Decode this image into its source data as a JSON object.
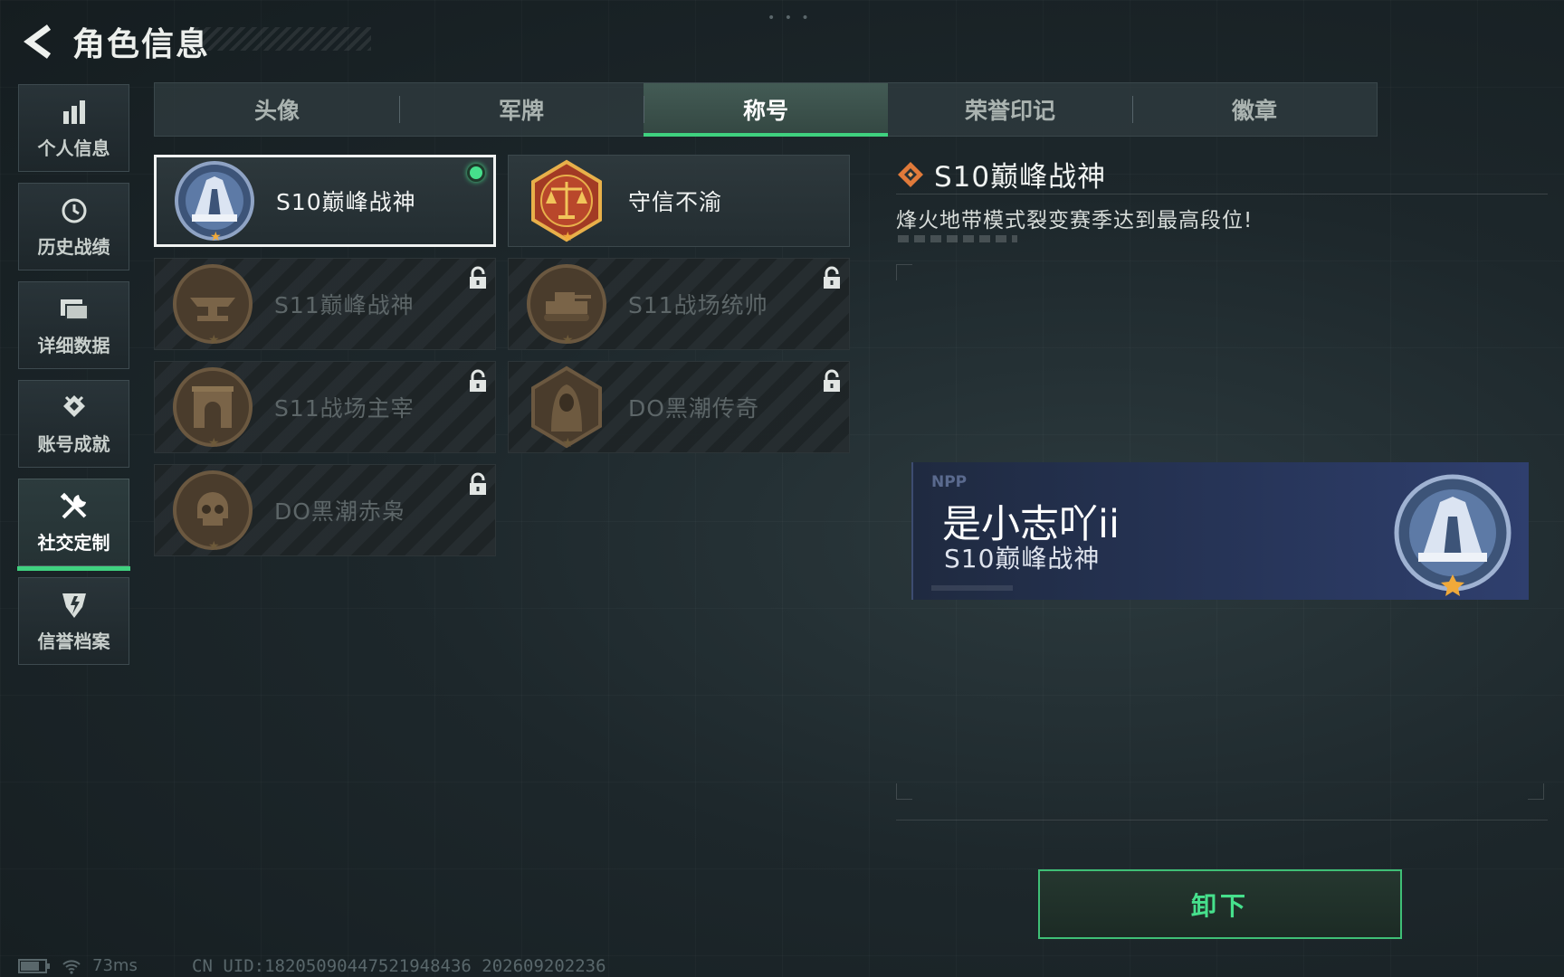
{
  "header": {
    "title": "角色信息"
  },
  "sidebar": {
    "items": [
      {
        "label": "个人信息",
        "icon": "bar-chart-icon"
      },
      {
        "label": "历史战绩",
        "icon": "clock-icon"
      },
      {
        "label": "详细数据",
        "icon": "folder-icon"
      },
      {
        "label": "账号成就",
        "icon": "achievement-icon"
      },
      {
        "label": "社交定制",
        "icon": "tools-icon",
        "active": true
      },
      {
        "label": "信誉档案",
        "icon": "shield-icon"
      }
    ]
  },
  "tabs": [
    {
      "label": "头像"
    },
    {
      "label": "军牌"
    },
    {
      "label": "称号",
      "active": true
    },
    {
      "label": "荣誉印记"
    },
    {
      "label": "徽章"
    }
  ],
  "titles": [
    {
      "name": "S10巅峰战神",
      "locked": false,
      "selected": true,
      "equipped": true,
      "icon": "peak-warrior-emblem-icon"
    },
    {
      "name": "守信不渝",
      "locked": false,
      "selected": false,
      "equipped": false,
      "icon": "scales-emblem-icon"
    },
    {
      "name": "S11巅峰战神",
      "locked": true,
      "icon": "anvil-emblem-icon"
    },
    {
      "name": "S11战场统帅",
      "locked": true,
      "icon": "tank-emblem-icon"
    },
    {
      "name": "S11战场主宰",
      "locked": true,
      "icon": "arch-emblem-icon"
    },
    {
      "name": "DO黑潮传奇",
      "locked": true,
      "icon": "hooded-figure-emblem-icon"
    },
    {
      "name": "DO黑潮赤枭",
      "locked": true,
      "icon": "skull-emblem-icon"
    }
  ],
  "detail": {
    "title": "S10巅峰战神",
    "description": "烽火地带模式裂变赛季达到最高段位!"
  },
  "nameplate": {
    "tag": "NPP",
    "player_name": "是小志吖ii",
    "title": "S10巅峰战神"
  },
  "actions": {
    "unequip_label": "卸下"
  },
  "status": {
    "ping": "73ms",
    "uid": "CN UID:18205090447521948436  202609202236"
  },
  "colors": {
    "accent_green": "#3fd17f",
    "equipped_dot": "#46e08c",
    "nameplate_blue": "#273559",
    "star_gold": "#f0a93a"
  }
}
